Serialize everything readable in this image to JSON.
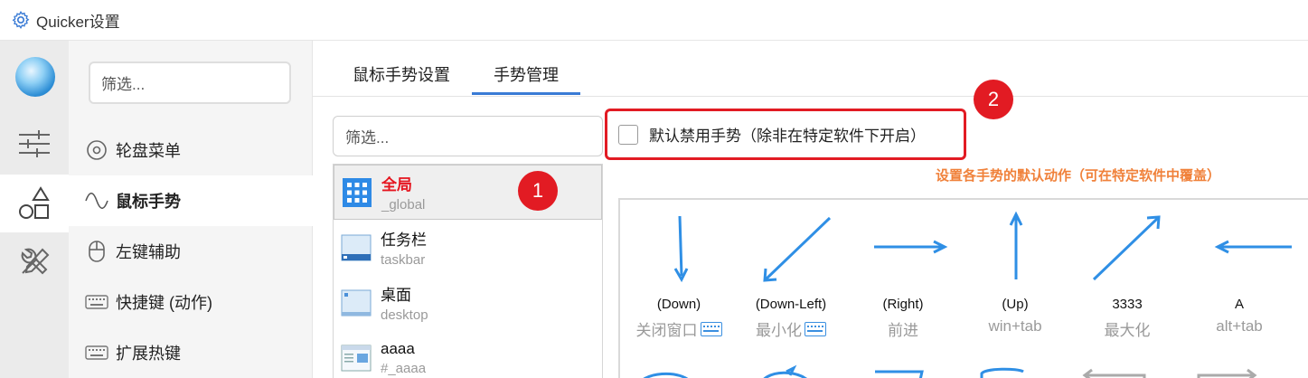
{
  "window": {
    "title": "Quicker设置"
  },
  "sidebar": {
    "filter_placeholder": "筛选...",
    "items": [
      {
        "label": "轮盘菜单",
        "icon": "radial-menu-icon"
      },
      {
        "label": "鼠标手势",
        "icon": "wave-icon",
        "active": true
      },
      {
        "label": "左键辅助",
        "icon": "mouse-icon"
      },
      {
        "label": "快捷键 (动作)",
        "icon": "keyboard-icon"
      },
      {
        "label": "扩展热键",
        "icon": "keyboard-icon"
      }
    ]
  },
  "rail": {
    "buttons": [
      "sliders-icon",
      "shapes-icon",
      "tools-icon"
    ],
    "active": "shapes-icon"
  },
  "tabs": [
    {
      "label": "鼠标手势设置",
      "active": false
    },
    {
      "label": "手势管理",
      "active": true
    }
  ],
  "app_list": {
    "filter_placeholder": "筛选...",
    "items": [
      {
        "name": "全局",
        "sub": "_global",
        "active": true
      },
      {
        "name": "任务栏",
        "sub": "taskbar"
      },
      {
        "name": "桌面",
        "sub": "desktop"
      },
      {
        "name": "aaaa",
        "sub": "#_aaaa"
      }
    ]
  },
  "badges": {
    "one": "1",
    "two": "2"
  },
  "disable_option": {
    "label": "默认禁用手势（除非在特定软件下开启）",
    "checked": false
  },
  "hint": "设置各手势的默认动作（可在特定软件中覆盖）",
  "gestures": [
    {
      "name": "(Down)",
      "action": "关闭窗口",
      "keyboard": true
    },
    {
      "name": "(Down-Left)",
      "action": "最小化",
      "keyboard": true
    },
    {
      "name": "(Right)",
      "action": "前进",
      "keyboard": false
    },
    {
      "name": "(Up)",
      "action": "win+tab",
      "keyboard": false
    },
    {
      "name": "3333",
      "action": "最大化",
      "keyboard": false
    },
    {
      "name": "A",
      "action": "alt+tab",
      "keyboard": false
    }
  ],
  "colors": {
    "accent": "#3a7bd5",
    "badge": "#e21b23",
    "hint": "#f0813a",
    "gesture": "#2f8fe5"
  }
}
